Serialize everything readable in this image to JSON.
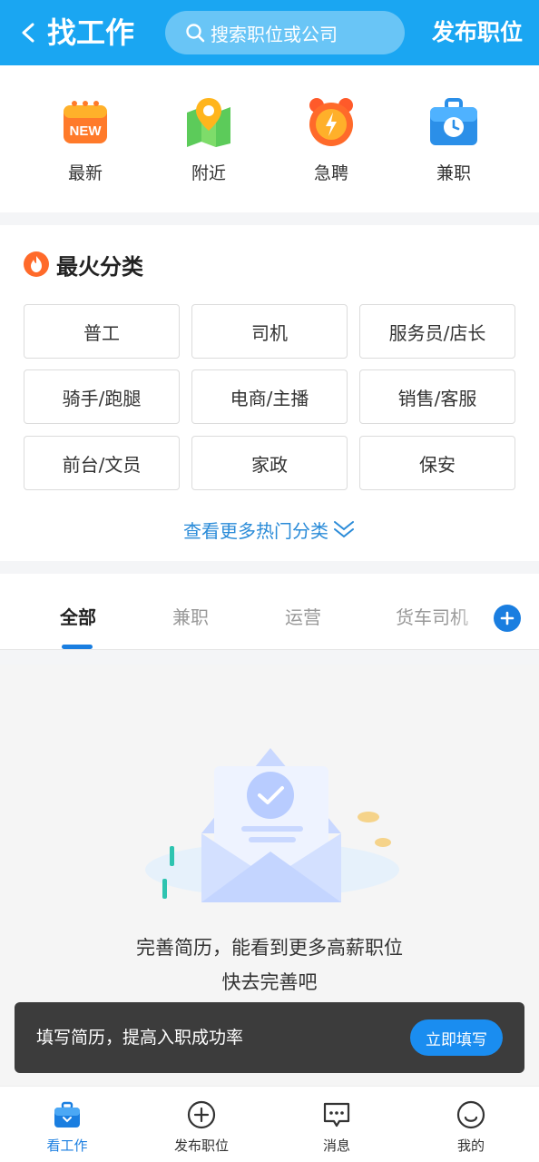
{
  "header": {
    "title": "找工作",
    "search_placeholder": "搜索职位或公司",
    "publish_label": "发布职位"
  },
  "quick_entries": [
    {
      "label": "最新",
      "icon": "new-calendar-icon"
    },
    {
      "label": "附近",
      "icon": "map-pin-icon"
    },
    {
      "label": "急聘",
      "icon": "alarm-clock-icon"
    },
    {
      "label": "兼职",
      "icon": "briefcase-clock-icon"
    }
  ],
  "hot_categories": {
    "title": "最火分类",
    "items": [
      "普工",
      "司机",
      "服务员/店长",
      "骑手/跑腿",
      "电商/主播",
      "销售/客服",
      "前台/文员",
      "家政",
      "保安"
    ],
    "more_label": "查看更多热门分类"
  },
  "tabs": {
    "items": [
      "全部",
      "兼职",
      "运营",
      "货车司机"
    ],
    "active_index": 0
  },
  "empty_state": {
    "line1": "完善简历，能看到更多高薪职位",
    "line2": "快去完善吧"
  },
  "banner": {
    "text": "填写简历，提高入职成功率",
    "button_label": "立即填写"
  },
  "bottom_nav": {
    "items": [
      {
        "label": "看工作",
        "icon": "briefcase-icon"
      },
      {
        "label": "发布职位",
        "icon": "plus-circle-icon"
      },
      {
        "label": "消息",
        "icon": "chat-bubble-icon"
      },
      {
        "label": "我的",
        "icon": "profile-icon"
      }
    ],
    "active_index": 0
  },
  "colors": {
    "brand": "#1aa6f2",
    "accent": "#1a7ee0",
    "link": "#2a8bd8",
    "banner_bg": "#3c3c3c"
  }
}
